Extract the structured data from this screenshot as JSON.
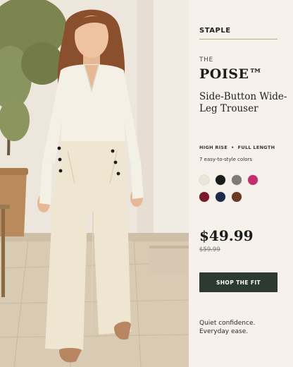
{
  "brand": "STAPLE",
  "product": {
    "eyebrow": "THE",
    "name": "POISE™",
    "subtitle": "Side-Button Wide-Leg Trouser",
    "features": [
      "HIGH RISE",
      "FULL LENGTH"
    ],
    "feature_separator": "•",
    "colors_note": "7 easy-to-style colors",
    "swatches": [
      {
        "name": "ivory",
        "color": "#ece6d8"
      },
      {
        "name": "black",
        "color": "#1b1b1b"
      },
      {
        "name": "grey",
        "color": "#7b7b7b"
      },
      {
        "name": "magenta",
        "color": "#c42d6e"
      },
      {
        "name": "burgundy",
        "color": "#7a1a2a"
      },
      {
        "name": "navy",
        "color": "#1d2a4a"
      },
      {
        "name": "brown",
        "color": "#6b3a24"
      }
    ]
  },
  "pricing": {
    "price": "$49.99",
    "original_price": "$59.99"
  },
  "cta": {
    "label": "SHOP THE FIT",
    "color": "#2c3a31"
  },
  "tagline": [
    "Quiet confidence.",
    "Everyday ease."
  ],
  "photo": {
    "description": "woman in cream blouse and cream wide-leg trousers"
  }
}
